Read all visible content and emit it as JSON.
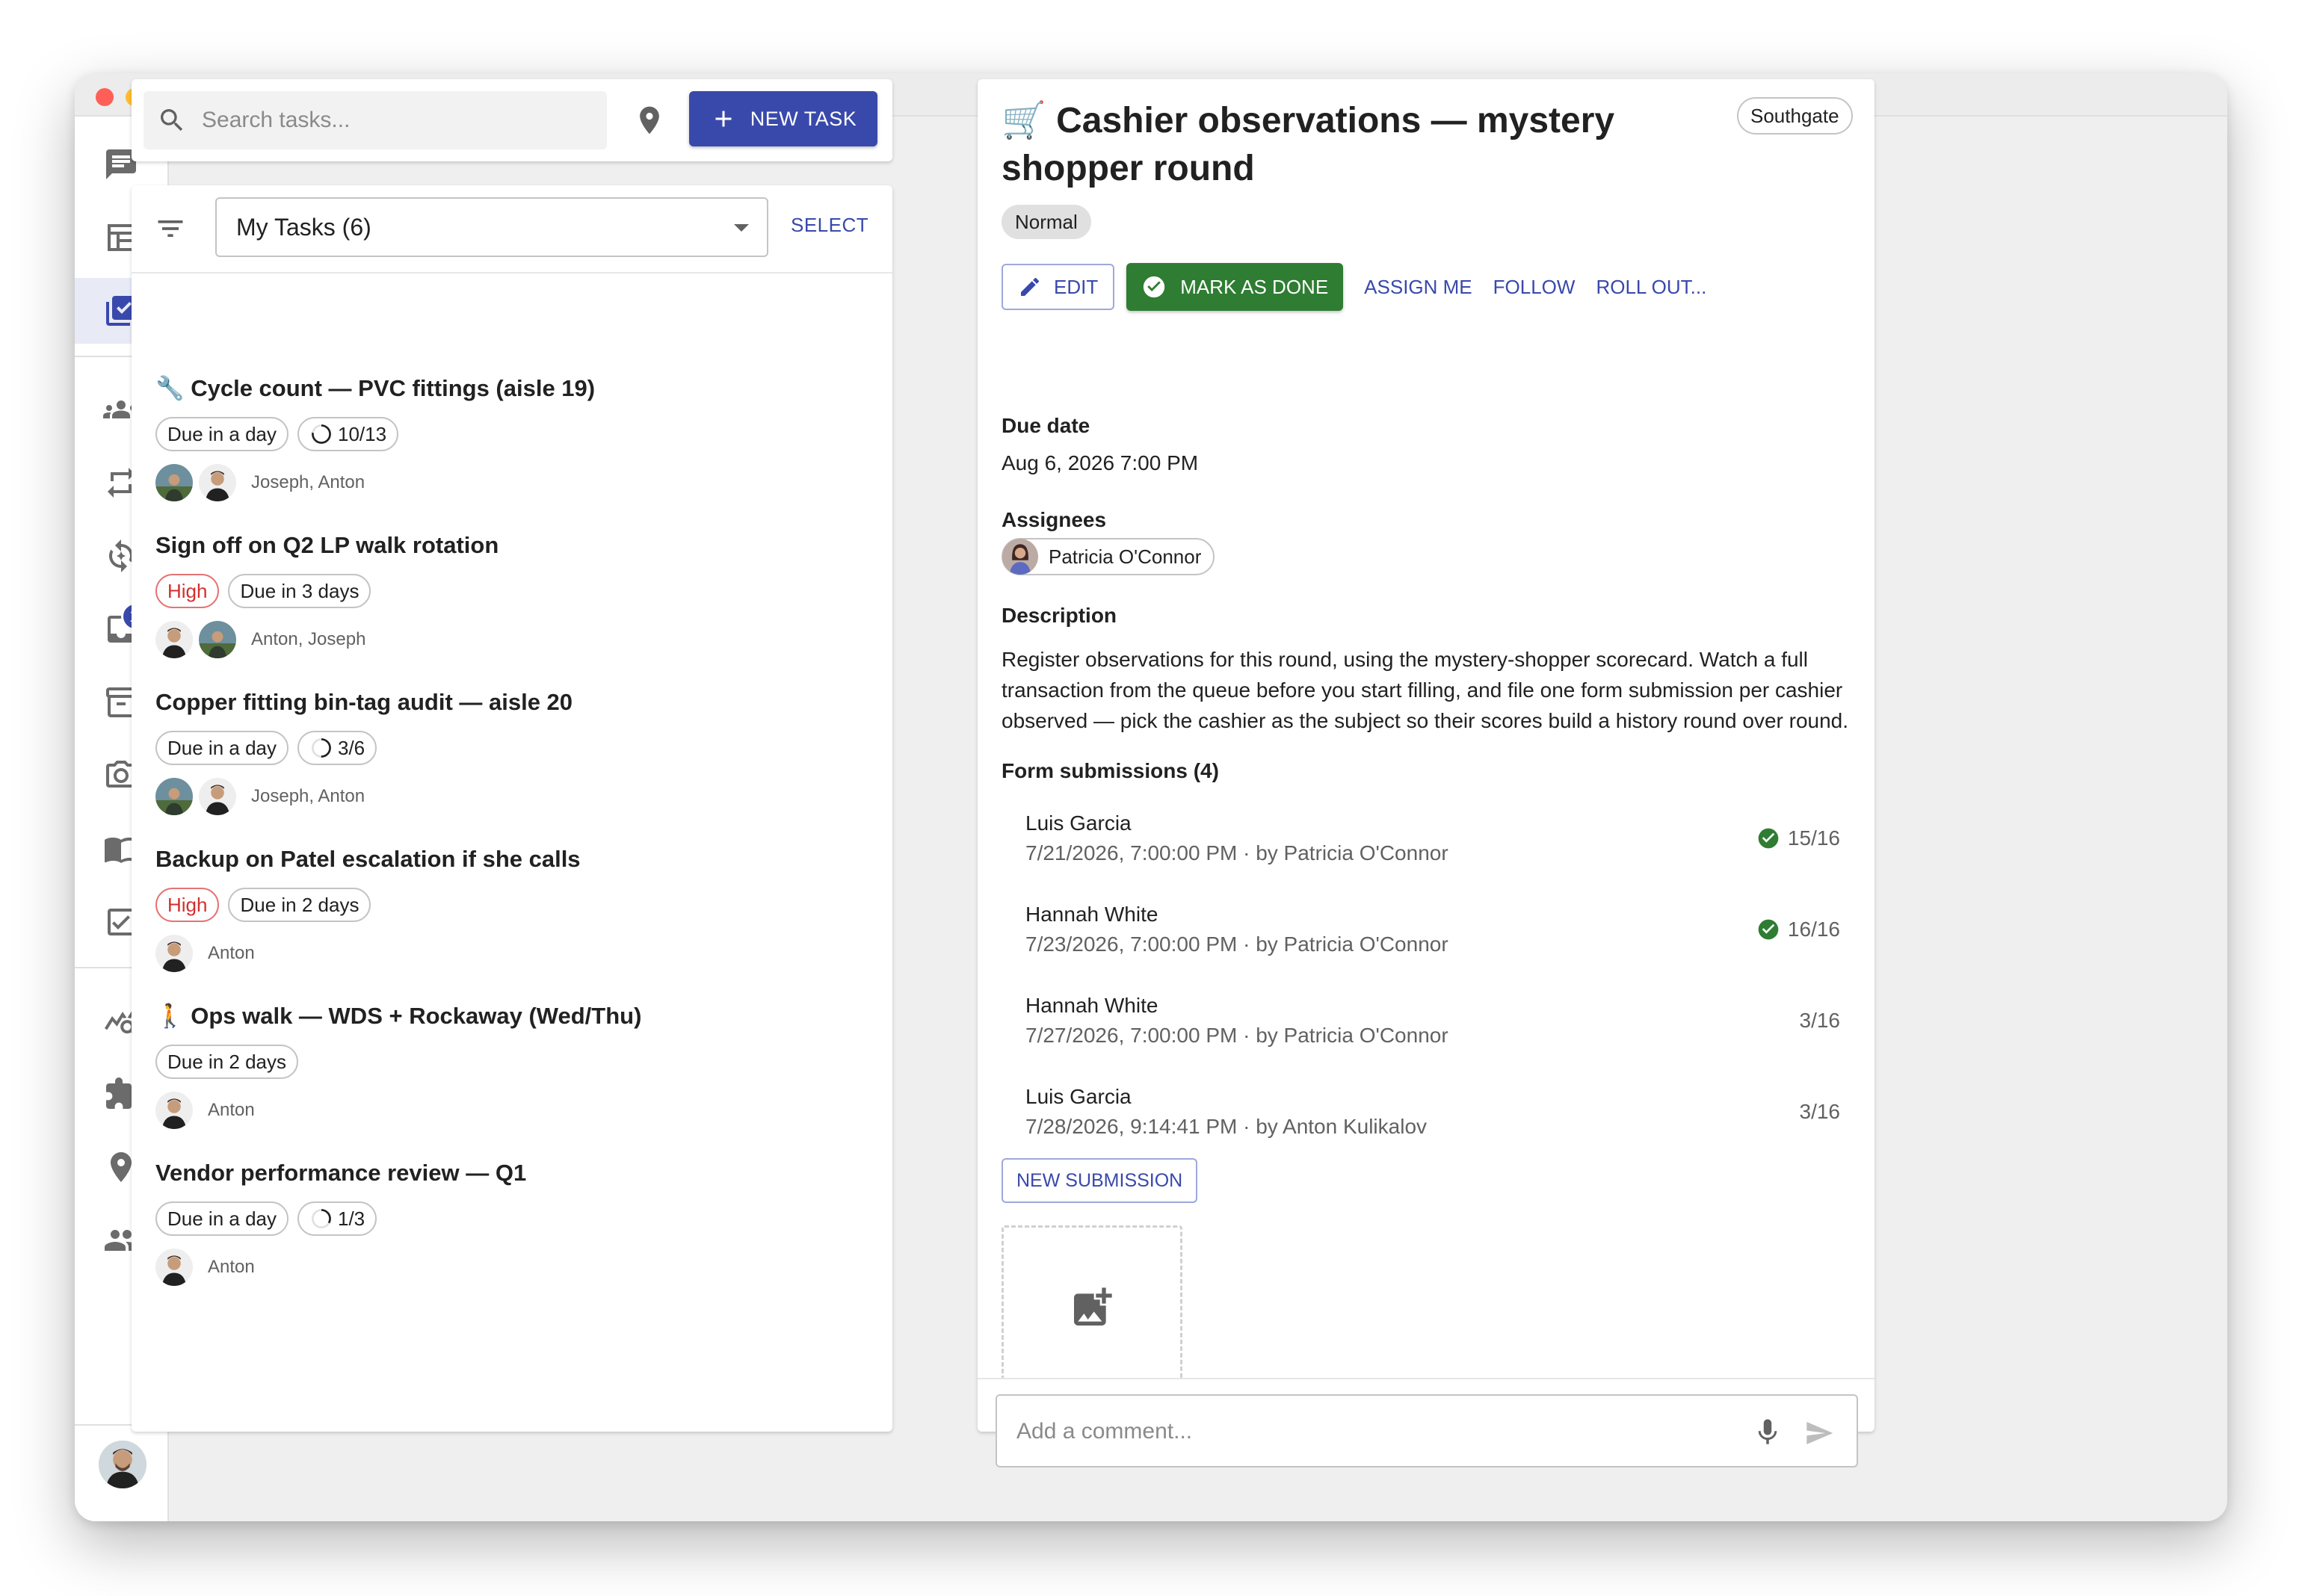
{
  "search": {
    "placeholder": "Search tasks..."
  },
  "toolbar": {
    "new_task_label": "NEW TASK"
  },
  "sidebar": {
    "inbox_badge": "16"
  },
  "list": {
    "filter_value": "My Tasks (6)",
    "select_label": "SELECT",
    "tasks": [
      {
        "title": "🔧 Cycle count — PVC fittings (aisle 19)",
        "chips": [
          "Due in a day"
        ],
        "progress": "10/13",
        "progress_fraction": 0.77,
        "assignees": "Joseph, Anton"
      },
      {
        "title": "Sign off on Q2 LP walk rotation",
        "priority": "High",
        "chips": [
          "Due in 3 days"
        ],
        "assignees": "Anton, Joseph"
      },
      {
        "title": "Copper fitting bin-tag audit — aisle 20",
        "chips": [
          "Due in a day"
        ],
        "progress": "3/6",
        "progress_fraction": 0.5,
        "assignees": "Joseph, Anton"
      },
      {
        "title": "Backup on Patel escalation if she calls",
        "priority": "High",
        "chips": [
          "Due in 2 days"
        ],
        "assignees": "Anton"
      },
      {
        "title": "🚶 Ops walk — WDS + Rockaway (Wed/Thu)",
        "chips": [
          "Due in 2 days"
        ],
        "assignees": "Anton"
      },
      {
        "title": "Vendor performance review — Q1",
        "chips": [
          "Due in a day"
        ],
        "progress": "1/3",
        "progress_fraction": 0.33,
        "assignees": "Anton"
      }
    ]
  },
  "detail": {
    "title": "🛒 Cashier observations — mystery shopper round",
    "store": "Southgate",
    "priority": "Normal",
    "actions": {
      "edit": "EDIT",
      "mark_done": "MARK AS DONE",
      "assign_me": "ASSIGN ME",
      "follow": "FOLLOW",
      "roll_out": "ROLL OUT..."
    },
    "due_label": "Due date",
    "due_value": "Aug 6, 2026 7:00 PM",
    "assignees_label": "Assignees",
    "assignee": "Patricia O'Connor",
    "description_label": "Description",
    "description": "Register observations for this round, using the mystery-shopper scorecard. Watch a full transaction from the queue before you start filling, and file one form submission per cashier observed — pick the cashier as the subject so their scores build a history round over round.",
    "submissions_label": "Form submissions (4)",
    "submissions": [
      {
        "name": "Luis Garcia",
        "meta": "7/21/2026, 7:00:00 PM · by Patricia O'Connor",
        "score": "15/16",
        "complete": true
      },
      {
        "name": "Hannah White",
        "meta": "7/23/2026, 7:00:00 PM · by Patricia O'Connor",
        "score": "16/16",
        "complete": true
      },
      {
        "name": "Hannah White",
        "meta": "7/27/2026, 7:00:00 PM · by Patricia O'Connor",
        "score": "3/16",
        "complete": false
      },
      {
        "name": "Luis Garcia",
        "meta": "7/28/2026, 9:14:41 PM · by Anton Kulikalov",
        "score": "3/16",
        "complete": false
      }
    ],
    "new_submission": "NEW SUBMISSION"
  },
  "comment": {
    "placeholder": "Add a comment..."
  },
  "colors": {
    "primary": "#3949ab",
    "success": "#2e7d32",
    "high": "#d32f2f"
  }
}
